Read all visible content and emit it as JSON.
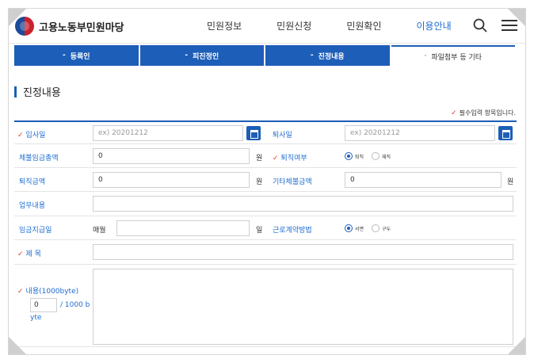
{
  "header": {
    "logo_text": "고용노동부민원마당",
    "nav": [
      "민원정보",
      "민원신청",
      "민원확인",
      "이용안내"
    ],
    "active_nav": "이용안내"
  },
  "tabs": [
    {
      "label": "등록인",
      "style": "blue",
      "prefix": "-"
    },
    {
      "label": "피진정인",
      "style": "blue",
      "prefix": "-"
    },
    {
      "label": "진정내용",
      "style": "blue",
      "prefix": "-"
    },
    {
      "label": "파일첨부 등 기타",
      "style": "light",
      "prefix": "·"
    }
  ],
  "section": {
    "title": "진정내용",
    "required_note": "필수입력 항목입니다."
  },
  "form": {
    "join_date": {
      "label": "입사일",
      "placeholder": "ex) 20201212",
      "required": true
    },
    "leave_date": {
      "label": "퇴사일",
      "placeholder": "ex) 20201212"
    },
    "unpaid_total": {
      "label": "체불임금총액",
      "value": "0",
      "unit": "원"
    },
    "resigned": {
      "label": "퇴직여부",
      "required": true,
      "options": [
        "퇴직",
        "재직"
      ],
      "selected": "퇴직"
    },
    "severance": {
      "label": "퇴직금액",
      "value": "0",
      "unit": "원"
    },
    "other_unpaid": {
      "label": "기타체불금액",
      "value": "0",
      "unit": "원"
    },
    "job_desc": {
      "label": "업무내용",
      "value": ""
    },
    "pay_day": {
      "label": "임금지급일",
      "prefix": "매월",
      "value": "",
      "unit": "일"
    },
    "contract_method": {
      "label": "근로계약방법",
      "options": [
        "서면",
        "구두"
      ],
      "selected": "서면"
    },
    "subject": {
      "label": "제 목",
      "required": true,
      "value": ""
    },
    "content": {
      "label": "내용(1000byte)",
      "required": true,
      "count": "0",
      "limit_text": "/ 1000 b",
      "limit_text2": "yte"
    }
  },
  "colors": {
    "accent": "#1d5eb8",
    "required": "#e23c2d",
    "label": "#1e6bd0"
  }
}
